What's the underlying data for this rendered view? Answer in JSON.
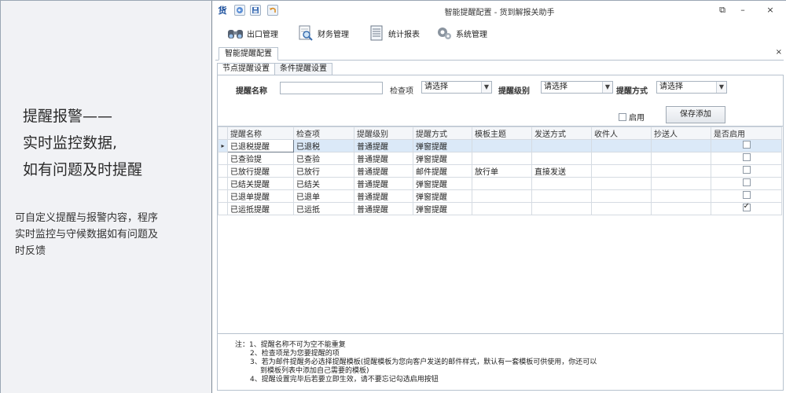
{
  "promo": {
    "headline": [
      "提醒报警——",
      "实时监控数据,",
      "如有问题及时提醒"
    ],
    "description_lines": [
      "可自定义提醒与报警内容，程序",
      "实时监控与守候数据如有问题及",
      "时反馈"
    ]
  },
  "window": {
    "app_logo": "货",
    "title": "智能提醒配置 - 货到解报关助手",
    "controls": {
      "pin": "⧉",
      "minimize": "–",
      "close": "×"
    },
    "quick_access_icons": [
      "back-icon",
      "save-icon",
      "undo-icon"
    ]
  },
  "menu": [
    {
      "label": "出口管理",
      "icon": "binoculars-icon"
    },
    {
      "label": "财务管理",
      "icon": "magnifier-doc-icon"
    },
    {
      "label": "统计报表",
      "icon": "report-icon"
    },
    {
      "label": "系统管理",
      "icon": "gears-icon"
    }
  ],
  "doc_tab": {
    "label": "智能提醒配置",
    "close": "×"
  },
  "sub_tabs": [
    {
      "label": "节点提醒设置",
      "active": true
    },
    {
      "label": "条件提醒设置",
      "active": false
    }
  ],
  "filters": {
    "name_label": "提醒名称",
    "name_value": "",
    "check_label": "检查项",
    "check_value": "请选择",
    "level_label": "提醒级别",
    "level_value": "请选择",
    "method_label": "提醒方式",
    "method_value": "请选择",
    "enable_label": "启用",
    "enable_checked": false,
    "save_button": "保存添加"
  },
  "grid": {
    "columns": [
      "提醒名称",
      "检查项",
      "提醒级别",
      "提醒方式",
      "模板主题",
      "发送方式",
      "收件人",
      "抄送人",
      "是否启用"
    ],
    "rows": [
      {
        "name": "已退税提醒",
        "check": "已退税",
        "level": "普通提醒",
        "method": "弹窗提醒",
        "template": "",
        "send": "",
        "to": "",
        "cc": "",
        "enabled": false,
        "selected": true
      },
      {
        "name": "已查验提",
        "check": "已查验",
        "level": "普通提醒",
        "method": "弹窗提醒",
        "template": "",
        "send": "",
        "to": "",
        "cc": "",
        "enabled": false,
        "selected": false
      },
      {
        "name": "已放行提醒",
        "check": "已放行",
        "level": "普通提醒",
        "method": "邮件提醒",
        "template": "放行单",
        "send": "直接发送",
        "to": "",
        "cc": "",
        "enabled": false,
        "selected": false
      },
      {
        "name": "已结关提醒",
        "check": "已结关",
        "level": "普通提醒",
        "method": "弹窗提醒",
        "template": "",
        "send": "",
        "to": "",
        "cc": "",
        "enabled": false,
        "selected": false
      },
      {
        "name": "已退单提醒",
        "check": "已退单",
        "level": "普通提醒",
        "method": "弹窗提醒",
        "template": "",
        "send": "",
        "to": "",
        "cc": "",
        "enabled": false,
        "selected": false
      },
      {
        "name": "已运抵提醒",
        "check": "已运抵",
        "level": "普通提醒",
        "method": "弹窗提醒",
        "template": "",
        "send": "",
        "to": "",
        "cc": "",
        "enabled": true,
        "selected": false
      }
    ]
  },
  "notes": {
    "prefix": "注：",
    "lines": [
      "1、提醒名称不可为空不能重复",
      "2、检查项是为您要提醒的项",
      "3、若为邮件提醒务必选择提醒模板(提醒模板为您向客户发送的邮件样式，默认有一套模板可供使用，你还可以",
      "到模板列表中添加自己需要的模板)",
      "4、提醒设置完毕后若要立即生效，请不要忘记勾选启用按钮"
    ]
  }
}
